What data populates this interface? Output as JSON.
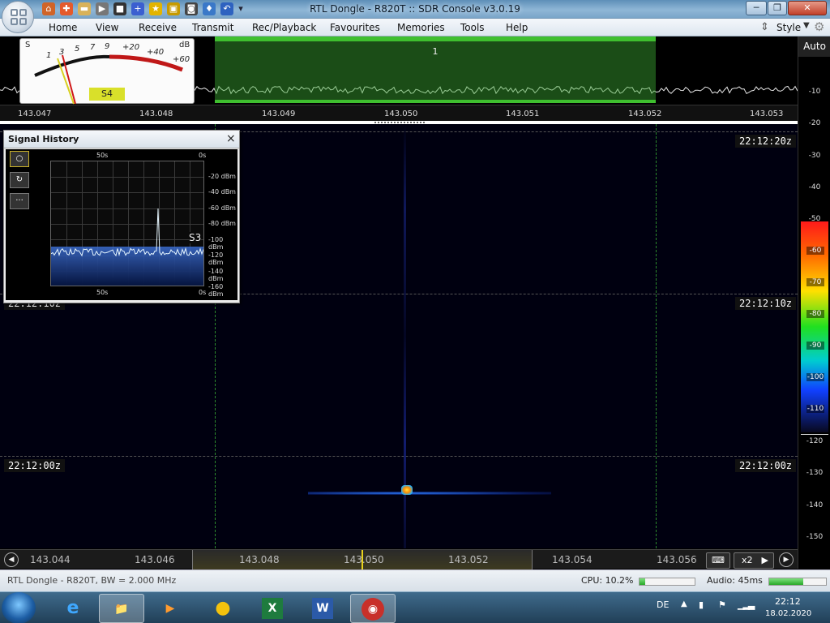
{
  "window": {
    "title": "RTL Dongle - R820T :: SDR Console v3.0.19"
  },
  "menu": {
    "items": [
      "Home",
      "View",
      "Receive",
      "Transmit",
      "Rec/Playback",
      "Favourites",
      "Memories",
      "Tools",
      "Help"
    ],
    "style_label": "Style"
  },
  "smeter": {
    "reading": "S4",
    "scale": [
      "S",
      "1",
      "3",
      "5",
      "7",
      "9",
      "+20",
      "+40",
      "+60",
      "dB"
    ]
  },
  "selection": {
    "label": "1"
  },
  "spectrum_axis": [
    "143.047",
    "143.048",
    "143.049",
    "143.050",
    "143.051",
    "143.052",
    "143.053"
  ],
  "waterfall": {
    "times_left": [
      "22:12:10z",
      "22:12:00z"
    ],
    "times_right": [
      "22:12:20z",
      "22:12:10z",
      "22:12:00z"
    ]
  },
  "db_scale": {
    "auto_label": "Auto",
    "labels": [
      "-10",
      "-20",
      "-30",
      "-40",
      "-50",
      "-60",
      "-70",
      "-80",
      "-90",
      "-100",
      "-110",
      "-120",
      "-130",
      "-140",
      "-150"
    ]
  },
  "tuning_axis": [
    "143.044",
    "143.046",
    "143.048",
    "143.050",
    "143.052",
    "143.054",
    "143.056"
  ],
  "tuning_buttons": {
    "zoom": "x2"
  },
  "signal_history": {
    "title": "Signal History",
    "close": "×",
    "top_labels": [
      "50s",
      "0s"
    ],
    "bottom_labels": [
      "50s",
      "0s"
    ],
    "y_labels": [
      "-20 dBm",
      "-40 dBm",
      "-60 dBm",
      "-80 dBm",
      "-100 dBm",
      "-120 dBm",
      "-140 dBm",
      "-160 dBm"
    ],
    "s_reading": "S3",
    "side_buttons": [
      "○",
      "↻",
      "···"
    ]
  },
  "status": {
    "left": "RTL Dongle - R820T, BW = 2.000 MHz",
    "cpu": "CPU: 10.2%",
    "cpu_fraction": 0.102,
    "audio": "Audio: 45ms",
    "audio_fraction": 0.6
  },
  "taskbar": {
    "lang": "DE",
    "time": "22:12",
    "date": "18.02.2020",
    "apps": [
      "e",
      "📁",
      "▶",
      "●",
      "X",
      "W",
      "◉"
    ]
  },
  "colors": {
    "selection_green": "#3fbf2f",
    "meter_red": "#c01818",
    "badge_yellow": "#d9e02a"
  }
}
